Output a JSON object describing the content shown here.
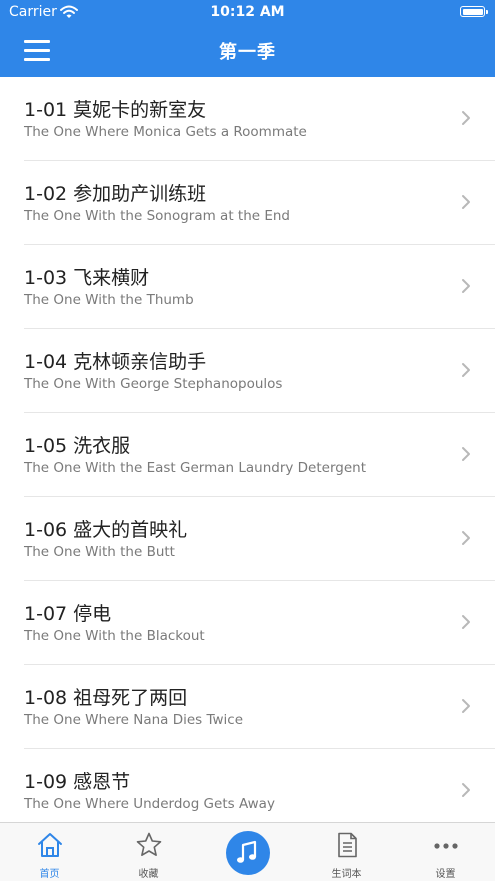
{
  "status_bar": {
    "carrier": "Carrier",
    "time": "10:12 AM"
  },
  "header": {
    "title": "第一季"
  },
  "episodes": [
    {
      "title": "1-01 莫妮卡的新室友",
      "subtitle": "The One Where Monica Gets a Roommate"
    },
    {
      "title": "1-02 参加助产训练班",
      "subtitle": "The One With the Sonogram at the End"
    },
    {
      "title": "1-03 飞来横财",
      "subtitle": "The One With the Thumb"
    },
    {
      "title": "1-04 克林顿亲信助手",
      "subtitle": "The One With George Stephanopoulos"
    },
    {
      "title": "1-05 洗衣服",
      "subtitle": "The One With the East German Laundry Detergent"
    },
    {
      "title": "1-06 盛大的首映礼",
      "subtitle": "The One With the Butt"
    },
    {
      "title": "1-07 停电",
      "subtitle": "The One With the Blackout"
    },
    {
      "title": "1-08 祖母死了两回",
      "subtitle": "The One Where Nana Dies Twice"
    },
    {
      "title": "1-09 感恩节",
      "subtitle": "The One Where Underdog Gets Away"
    }
  ],
  "tabs": [
    {
      "label": "首页",
      "icon": "home-icon",
      "active": true
    },
    {
      "label": "收藏",
      "icon": "star-icon",
      "active": false
    },
    {
      "label": "",
      "icon": "music-note-icon",
      "active": false
    },
    {
      "label": "生词本",
      "icon": "document-icon",
      "active": false
    },
    {
      "label": "设置",
      "icon": "more-icon",
      "active": false
    }
  ],
  "colors": {
    "accent": "#2f86e8",
    "text": "#222222",
    "subtext": "#7a7a7a"
  }
}
